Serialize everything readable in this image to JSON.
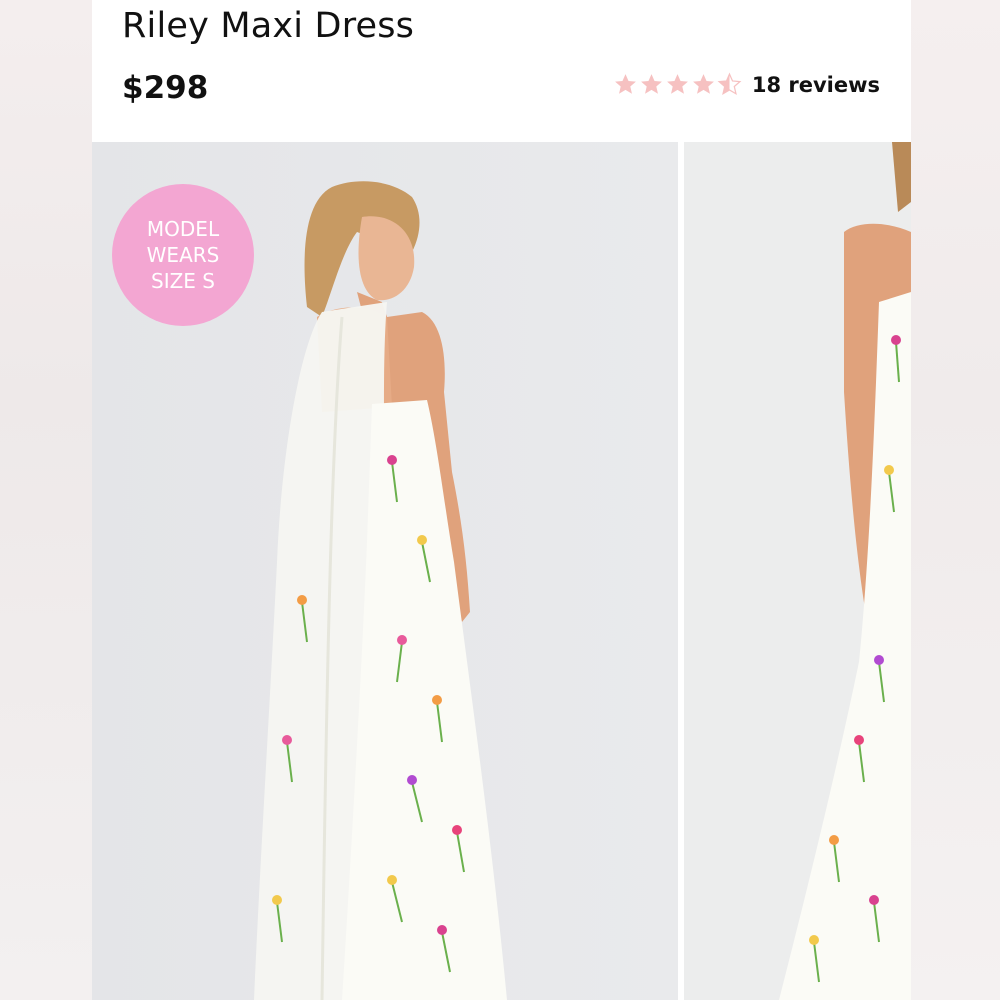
{
  "product": {
    "title": "Riley Maxi Dress",
    "price": "$298",
    "rating": 4.5,
    "rating_max": 5,
    "reviews_label": "18 reviews"
  },
  "gallery": {
    "badge_lines": [
      "MODEL",
      "WEARS",
      "SIZE S"
    ]
  },
  "colors": {
    "star": "#f6c1c1",
    "badge": "#f3a6d2",
    "photo_bg": "#e7e8ea"
  }
}
